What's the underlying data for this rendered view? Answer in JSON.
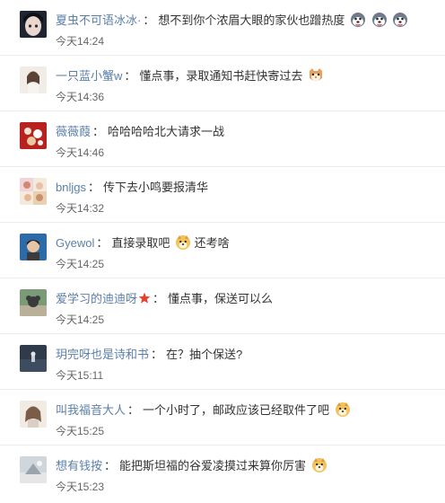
{
  "comments": [
    {
      "user": "夏虫不可语冰冰·",
      "text": "想不到你个浓眉大眼的家伙也蹭热度",
      "time": "今天14:24",
      "emoji": "husky-face-emoji"
    },
    {
      "user": "一只蓝小蟹w",
      "text": "懂点事，录取通知书赶快寄过去",
      "time": "今天14:36",
      "emoji": "cat-face-emoji"
    },
    {
      "user": "薇薇葭",
      "text": "哈哈哈哈北大请求一战",
      "time": "今天14:46"
    },
    {
      "user": "bnljgs",
      "text": "传下去小鸣要报清华",
      "time": "今天14:32"
    },
    {
      "user": "Gyewol",
      "text": "直接录取吧",
      "text_after": "还考啥",
      "time": "今天14:25",
      "emoji": "doge-emoji"
    },
    {
      "user": "爱学习的迪迪呀",
      "text": "懂点事，保送可以么",
      "time": "今天14:25",
      "badge": "star-badge"
    },
    {
      "user": "玥完呀也是诗和书",
      "text": "在？抽个保送?",
      "time": "今天15:11"
    },
    {
      "user": "叫我福音大人",
      "text": "一个小时了，邮政应该已经取件了吧",
      "time": "今天15:25",
      "emoji": "doge-emoji"
    },
    {
      "user": "想有钱按",
      "text": "能把斯坦福的谷爱凌摸过来算你厉害",
      "time": "今天15:23",
      "emoji": "doge-emoji"
    }
  ],
  "colors": {
    "username": "#5b7fa9",
    "text": "#333333",
    "time": "#666666",
    "divider": "#ececec"
  }
}
